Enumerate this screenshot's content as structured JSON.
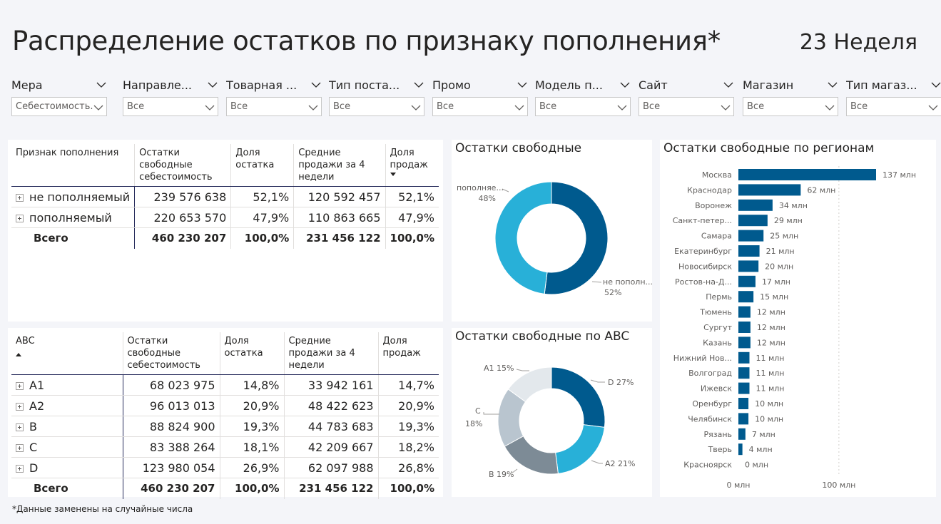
{
  "header": {
    "title": "Распределение остатков по признаку пополнения*",
    "week": "23 Неделя"
  },
  "slicers": [
    {
      "label": "Мера",
      "value": "Себестоимость..."
    },
    {
      "label": "Направле...",
      "value": "Все"
    },
    {
      "label": "Товарная ...",
      "value": "Все"
    },
    {
      "label": "Тип поста...",
      "value": "Все"
    },
    {
      "label": "Промо",
      "value": "Все"
    },
    {
      "label": "Модель п...",
      "value": "Все"
    },
    {
      "label": "Сайт",
      "value": "Все"
    },
    {
      "label": "Магазин",
      "value": "Все"
    },
    {
      "label": "Тип магаз...",
      "value": "Все"
    }
  ],
  "table1": {
    "headers": [
      "Признак пополнения",
      "Остатки свободные себестоимость",
      "Доля остатка",
      "Средние продажи за 4 недели",
      "Доля продаж"
    ],
    "rows": [
      {
        "name": "не пополняемый",
        "stock": "239 576 638",
        "share": "52,1%",
        "sales": "120 592 457",
        "sales_share": "52,1%"
      },
      {
        "name": "пополняемый",
        "stock": "220 653 570",
        "share": "47,9%",
        "sales": "110 863 665",
        "sales_share": "47,9%"
      }
    ],
    "total": {
      "name": "Всего",
      "stock": "460 230 207",
      "share": "100,0%",
      "sales": "231 456 122",
      "sales_share": "100,0%"
    }
  },
  "table2": {
    "headers": [
      "ABC",
      "Остатки свободные себестоимость",
      "Доля остатка",
      "Средние продажи за 4 недели",
      "Доля продаж"
    ],
    "rows": [
      {
        "name": "A1",
        "stock": "68 023 975",
        "share": "14,8%",
        "sales": "33 942 161",
        "sales_share": "14,7%"
      },
      {
        "name": "A2",
        "stock": "96 013 013",
        "share": "20,9%",
        "sales": "48 422 623",
        "sales_share": "20,9%"
      },
      {
        "name": "B",
        "stock": "88 824 900",
        "share": "19,3%",
        "sales": "44 783 683",
        "sales_share": "19,3%"
      },
      {
        "name": "C",
        "stock": "83 388 264",
        "share": "18,1%",
        "sales": "42 209 667",
        "sales_share": "18,2%"
      },
      {
        "name": "D",
        "stock": "123 980 054",
        "share": "26,9%",
        "sales": "62 097 988",
        "sales_share": "26,8%"
      }
    ],
    "total": {
      "name": "Всего",
      "stock": "460 230 207",
      "share": "100,0%",
      "sales": "231 456 122",
      "sales_share": "100,0%"
    }
  },
  "colors": {
    "dark_blue": "#005a8e",
    "cyan": "#28b0d8",
    "gray": "#7d8b96",
    "light_gray": "#b9c5cf",
    "pale_gray": "#e3e8ec"
  },
  "chart_data": [
    {
      "type": "pie",
      "title": "Остатки свободные",
      "donut": true,
      "slices": [
        {
          "label": "не пополн...",
          "value": 52,
          "display": "52%",
          "color": "#005a8e"
        },
        {
          "label": "пополняе...",
          "value": 48,
          "display": "48%",
          "color": "#28b0d8"
        }
      ]
    },
    {
      "type": "pie",
      "title": "Остатки свободные по ABC",
      "donut": true,
      "slices": [
        {
          "label": "D",
          "value": 27,
          "display": "D 27%",
          "color": "#005a8e"
        },
        {
          "label": "A2",
          "value": 21,
          "display": "A2 21%",
          "color": "#28b0d8"
        },
        {
          "label": "B",
          "value": 19,
          "display": "B 19%",
          "color": "#7d8b96"
        },
        {
          "label": "C",
          "value": 18,
          "display": "C 18%",
          "color": "#b9c5cf"
        },
        {
          "label": "A1",
          "value": 15,
          "display": "A1 15%",
          "color": "#e3e8ec"
        }
      ]
    },
    {
      "type": "bar",
      "title": "Остатки свободные по регионам",
      "orientation": "horizontal",
      "categories": [
        "Москва",
        "Краснодар",
        "Воронеж",
        "Санкт-петер...",
        "Самара",
        "Екатеринбург",
        "Новосибирск",
        "Ростов-на-Д...",
        "Пермь",
        "Тюмень",
        "Сургут",
        "Казань",
        "Нижний Нов...",
        "Волгоград",
        "Ижевск",
        "Оренбург",
        "Челябинск",
        "Рязань",
        "Тверь",
        "Красноярск"
      ],
      "values": [
        137,
        62,
        34,
        29,
        25,
        21,
        20,
        17,
        15,
        12,
        12,
        12,
        11,
        11,
        11,
        10,
        10,
        7,
        4,
        0
      ],
      "value_labels": [
        "137 млн",
        "62 млн",
        "34 млн",
        "29 млн",
        "25 млн",
        "21 млн",
        "20 млн",
        "17 млн",
        "15 млн",
        "12 млн",
        "12 млн",
        "12 млн",
        "11 млн",
        "11 млн",
        "11 млн",
        "10 млн",
        "10 млн",
        "7 млн",
        "4 млн",
        "0 млн"
      ],
      "x_ticks": [
        "0 млн",
        "100 млн"
      ],
      "xlim": [
        0,
        137
      ],
      "color": "#005a8e"
    }
  ],
  "footnote": "*Данные заменены на случайные числа"
}
